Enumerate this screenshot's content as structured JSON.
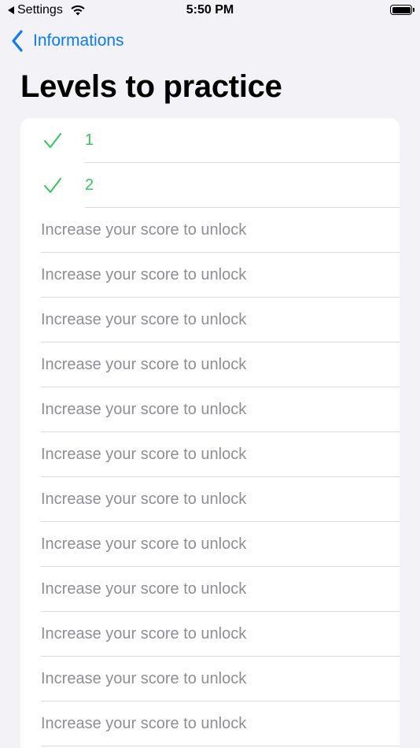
{
  "status_bar": {
    "back_app": "Settings",
    "time": "5:50 PM"
  },
  "nav": {
    "back_label": "Informations"
  },
  "page": {
    "title": "Levels to practice"
  },
  "levels": {
    "unlocked": [
      {
        "label": "1"
      },
      {
        "label": "2"
      }
    ],
    "locked": [
      {
        "label": "Increase your score to unlock"
      },
      {
        "label": "Increase your score to unlock"
      },
      {
        "label": "Increase your score to unlock"
      },
      {
        "label": "Increase your score to unlock"
      },
      {
        "label": "Increase your score to unlock"
      },
      {
        "label": "Increase your score to unlock"
      },
      {
        "label": "Increase your score to unlock"
      },
      {
        "label": "Increase your score to unlock"
      },
      {
        "label": "Increase your score to unlock"
      },
      {
        "label": "Increase your score to unlock"
      },
      {
        "label": "Increase your score to unlock"
      },
      {
        "label": "Increase your score to unlock"
      }
    ]
  },
  "colors": {
    "accent": "#0a7aff",
    "unlocked": "#34c759",
    "locked_text": "#8e8e93",
    "background": "#f2f2f7"
  }
}
